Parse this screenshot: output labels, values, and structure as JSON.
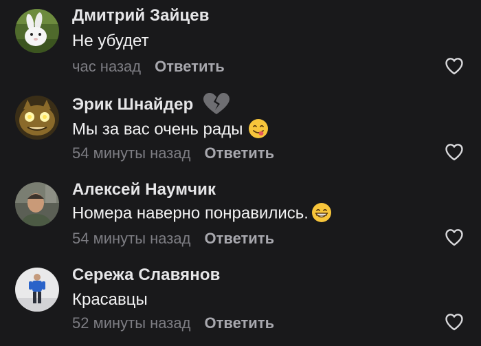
{
  "comments": [
    {
      "author": "Дмитрий Зайцев",
      "text": "Не убудет",
      "time": "час назад",
      "reply_label": "Ответить",
      "avatar": "rabbit-avatar"
    },
    {
      "author": "Эрик Шнайдер",
      "badge": "broken-heart-icon",
      "text": "Мы за вас очень рады",
      "emoji": "yum-face-emoji",
      "time": "54 минуты назад",
      "reply_label": "Ответить",
      "avatar": "catbus-avatar"
    },
    {
      "author": "Алексей Наумчик",
      "text": "Номера наверно понравились.",
      "emoji": "grinning-face-emoji",
      "time": "54 минуты назад",
      "reply_label": "Ответить",
      "avatar": "person-photo-avatar"
    },
    {
      "author": "Сережа Славянов",
      "text": "Красавцы",
      "time": "52 минуты назад",
      "reply_label": "Ответить",
      "avatar": "person-standing-avatar"
    }
  ],
  "colors": {
    "background": "#19191b",
    "author": "#e6e6e8",
    "text": "#f2f2f3",
    "time": "#7d7d83",
    "reply": "#a8a8ae",
    "like_icon": "#d9d9dc"
  }
}
